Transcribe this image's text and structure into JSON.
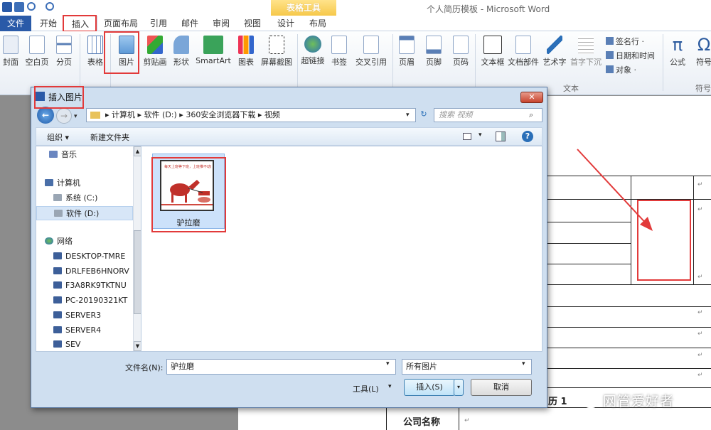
{
  "window": {
    "title": "个人简历模板 - Microsoft Word",
    "context_group": "表格工具"
  },
  "tabs": [
    "文件",
    "开始",
    "插入",
    "页面布局",
    "引用",
    "邮件",
    "审阅",
    "视图",
    "设计",
    "布局"
  ],
  "ribbon": {
    "buttons": [
      "封面",
      "空白页",
      "分页",
      "表格",
      "图片",
      "剪贴画",
      "形状",
      "SmartArt",
      "图表",
      "屏幕截图",
      "超链接",
      "书签",
      "交叉引用",
      "页眉",
      "页脚",
      "页码",
      "文本框",
      "文档部件",
      "艺术字",
      "首字下沉",
      "公式",
      "符号"
    ],
    "small_items": [
      "签名行 ·",
      "日期和时间",
      "对象 ·"
    ],
    "group_labels": [
      "文本",
      "符号"
    ]
  },
  "dialog": {
    "title": "插入图片",
    "breadcrumb": [
      "计算机",
      "软件 (D:)",
      "360安全浏览器下载",
      "视频"
    ],
    "search_placeholder": "搜索 视频",
    "toolbar": {
      "organize": "组织 ▾",
      "new_folder": "新建文件夹"
    },
    "nav_items": [
      "音乐",
      "计算机",
      "系统 (C:)",
      "软件 (D:)",
      "网络",
      "DESKTOP-TMRE",
      "DRLFEB6HNORV",
      "F3A8RK9TKTNU",
      "PC-20190321KT",
      "SERVER3",
      "SERVER4",
      "SEV"
    ],
    "file": {
      "name": "驴拉磨",
      "thumb_caption": "每天上班等下班，上班推不动磨"
    },
    "filename_label": "文件名(N):",
    "filename_value": "驴拉磨",
    "filetype_value": "所有图片",
    "tools_label": "工具(L)",
    "insert_label": "插入(S)",
    "cancel_label": "取消"
  },
  "document": {
    "section_text": "历 1",
    "company_label": "公司名称"
  },
  "watermark": "网管爱好者"
}
